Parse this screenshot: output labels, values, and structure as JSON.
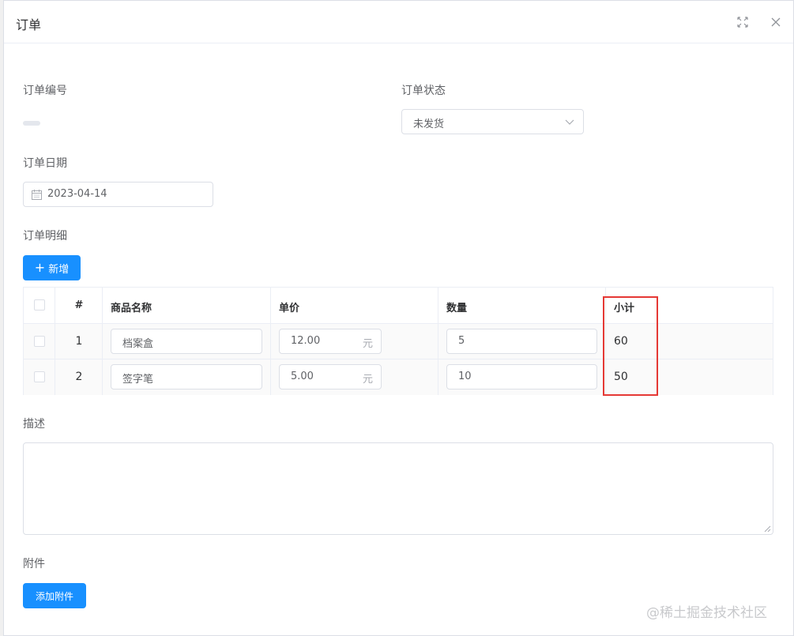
{
  "dialog": {
    "title": "订单",
    "maximize_icon": "maximize-icon",
    "close_icon": "close-icon"
  },
  "form": {
    "order_no_label": "订单编号",
    "order_status_label": "订单状态",
    "order_status_value": "未发货",
    "order_date_label": "订单日期",
    "order_date_value": "2023-04-14",
    "details_label": "订单明细",
    "add_button": "新增",
    "description_label": "描述",
    "description_value": "",
    "attachment_label": "附件",
    "attachment_button": "添加附件"
  },
  "table": {
    "headers": [
      "#",
      "商品名称",
      "单价",
      "数量",
      "小计"
    ],
    "rows": [
      {
        "index": "1",
        "name": "档案盒",
        "price": "12.00",
        "price_unit": "元",
        "quantity": "5",
        "subtotal": "60"
      },
      {
        "index": "2",
        "name": "签字笔",
        "price": "5.00",
        "price_unit": "元",
        "quantity": "10",
        "subtotal": "50"
      }
    ]
  },
  "watermark": "@稀土掘金技术社区",
  "colors": {
    "primary": "#1890ff",
    "highlight": "#e53935",
    "border": "#dcdfe6"
  }
}
